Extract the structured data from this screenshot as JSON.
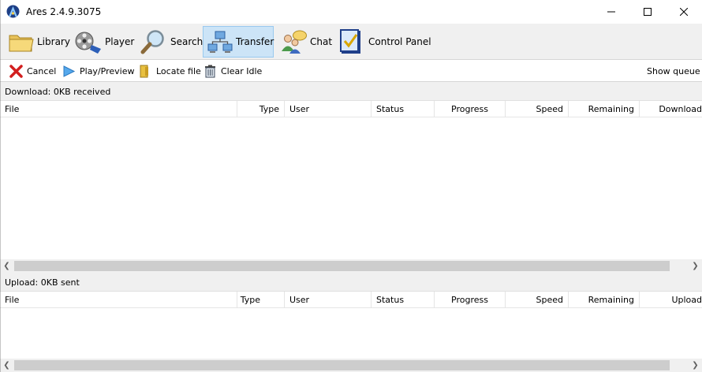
{
  "window": {
    "title": "Ares 2.4.9.3075"
  },
  "main_toolbar": {
    "items": [
      {
        "label": "Library",
        "icon": "folder-icon"
      },
      {
        "label": "Player",
        "icon": "film-reel-icon"
      },
      {
        "label": "Search",
        "icon": "magnifier-icon"
      },
      {
        "label": "Transfer",
        "icon": "network-icon",
        "active": true
      },
      {
        "label": "Chat",
        "icon": "chat-users-icon"
      },
      {
        "label": "Control Panel",
        "icon": "checklist-icon"
      }
    ]
  },
  "sub_toolbar": {
    "cancel": "Cancel",
    "play_preview": "Play/Preview",
    "locate_file": "Locate file",
    "clear_idle": "Clear Idle",
    "show_queue": "Show queue"
  },
  "download": {
    "label": "Download: 0KB received",
    "columns": [
      "File",
      "Type",
      "User",
      "Status",
      "Progress",
      "Speed",
      "Remaining",
      "Download"
    ]
  },
  "upload": {
    "label": "Upload: 0KB sent",
    "columns": [
      "File",
      "Type",
      "User",
      "Status",
      "Progress",
      "Speed",
      "Remaining",
      "Upload"
    ]
  },
  "colors": {
    "accent_selected": "#cce4f7",
    "toolbar_bg": "#f0f0f0"
  }
}
